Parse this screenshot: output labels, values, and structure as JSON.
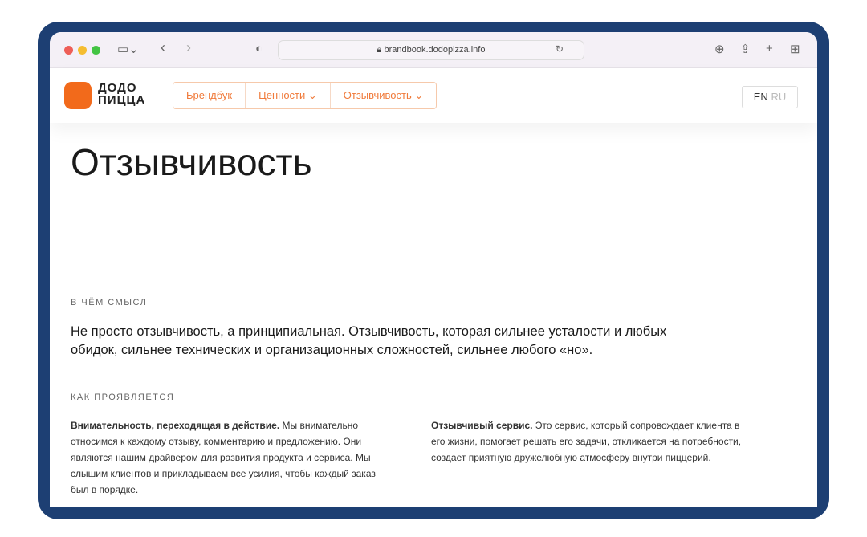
{
  "browser": {
    "url": "brandbook.dodopizza.info"
  },
  "header": {
    "logo_line1": "ДОДО",
    "logo_line2": "ПИЦЦА",
    "breadcrumbs": [
      "Брендбук",
      "Ценности",
      "Отзывчивость"
    ],
    "lang_en": "EN",
    "lang_ru": "RU"
  },
  "main": {
    "title": "Отзывчивость",
    "section1_label": "В ЧЁМ СМЫСЛ",
    "section1_text": "Не просто отзывчивость, а принципиальная. Отзывчивость, которая сильнее усталости и любых обидок, сильнее технических и организационных сложностей, сильнее любого «но».",
    "section2_label": "КАК ПРОЯВЛЯЕТСЯ",
    "col1_bold": "Внимательность, переходящая в действие.",
    "col1_text": " Мы внимательно относимся к каждому отзыву, комментарию и предложению. Они являются нашим драйвером для развития продукта и сервиса. Мы слышим клиентов и прикладываем все усилия, чтобы каждый заказ был в порядке.",
    "col2_bold": "Отзывчивый сервис.",
    "col2_text": " Это сервис, который сопровождает клиента в его жизни, помогает решать его задачи, откликается на потребности, создает приятную дружелюбную атмосферу внутри пиццерий."
  },
  "colors": {
    "frame": "#1d3f73",
    "accent": "#f26a1b"
  }
}
